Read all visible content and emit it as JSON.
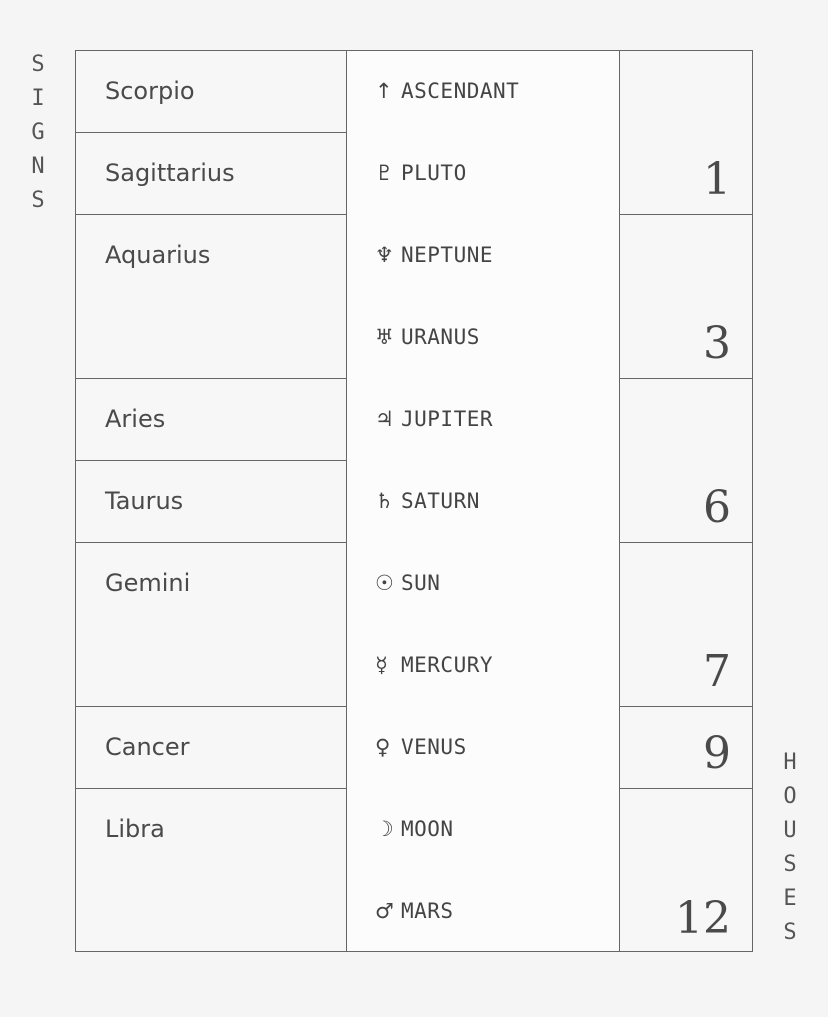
{
  "labels": {
    "signs": [
      "S",
      "I",
      "G",
      "N",
      "S"
    ],
    "houses": [
      "H",
      "O",
      "U",
      "S",
      "E",
      "S"
    ]
  },
  "signs": [
    {
      "name": "Scorpio",
      "rows": 1
    },
    {
      "name": "Sagittarius",
      "rows": 1
    },
    {
      "name": "Aquarius",
      "rows": 2
    },
    {
      "name": "Aries",
      "rows": 1
    },
    {
      "name": "Taurus",
      "rows": 1
    },
    {
      "name": "Gemini",
      "rows": 2
    },
    {
      "name": "Cancer",
      "rows": 1
    },
    {
      "name": "Libra",
      "rows": 2
    }
  ],
  "planets": [
    {
      "glyph": "↑",
      "name": "ASCENDANT",
      "icon": "ascendant-icon"
    },
    {
      "glyph": "♇",
      "name": "PLUTO",
      "icon": "pluto-icon"
    },
    {
      "glyph": "♆",
      "name": "NEPTUNE",
      "icon": "neptune-icon"
    },
    {
      "glyph": "♅",
      "name": "URANUS",
      "icon": "uranus-icon"
    },
    {
      "glyph": "♃",
      "name": "JUPITER",
      "icon": "jupiter-icon"
    },
    {
      "glyph": "♄",
      "name": "SATURN",
      "icon": "saturn-icon"
    },
    {
      "glyph": "☉",
      "name": "SUN",
      "icon": "sun-icon"
    },
    {
      "glyph": "☿",
      "name": "MERCURY",
      "icon": "mercury-icon"
    },
    {
      "glyph": "♀",
      "name": "VENUS",
      "icon": "venus-icon"
    },
    {
      "glyph": "☽",
      "name": "MOON",
      "icon": "moon-icon"
    },
    {
      "glyph": "♂",
      "name": "MARS",
      "icon": "mars-icon"
    }
  ],
  "houses": [
    {
      "number": "1",
      "rows": 2
    },
    {
      "number": "3",
      "rows": 2
    },
    {
      "number": "6",
      "rows": 2
    },
    {
      "number": "7",
      "rows": 2
    },
    {
      "number": "9",
      "rows": 1
    },
    {
      "number": "12",
      "rows": 2
    }
  ]
}
